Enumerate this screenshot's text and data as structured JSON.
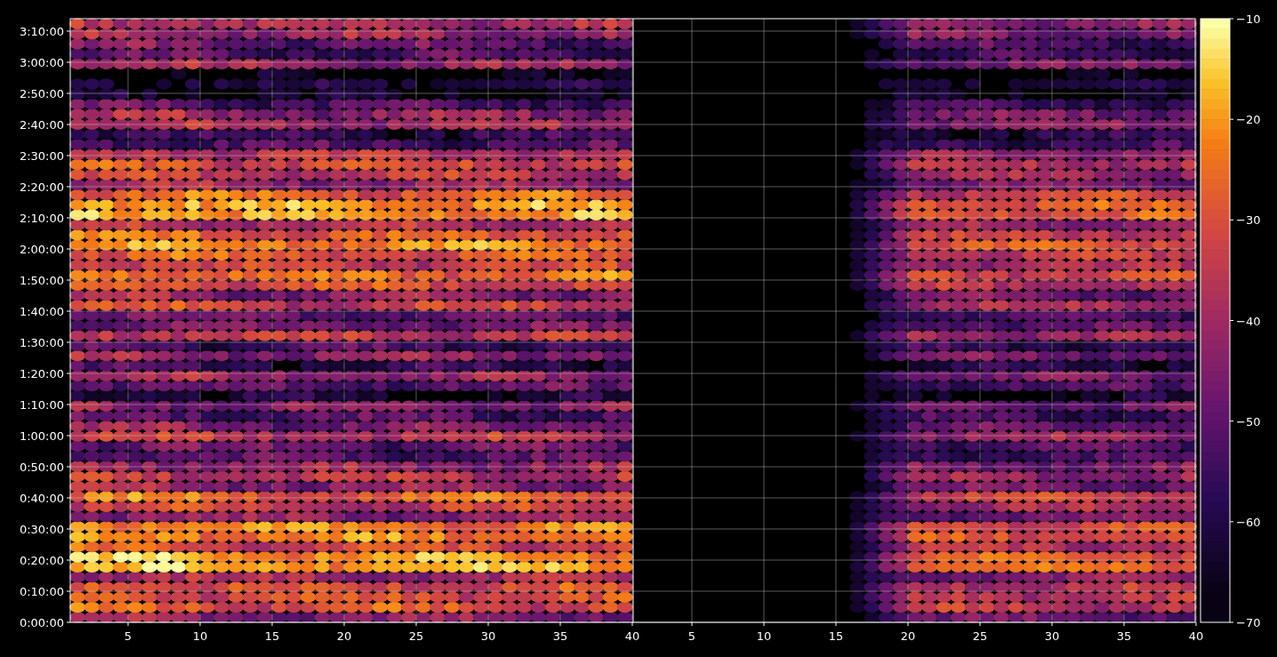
{
  "left_panel": {
    "x_ticks": [
      "5",
      "10",
      "15",
      "20",
      "25",
      "30",
      "35",
      "40"
    ]
  },
  "right_panel": {
    "x_ticks": [
      "5",
      "10",
      "15",
      "20",
      "25",
      "30",
      "35",
      "40"
    ]
  },
  "y_ticks": [
    "3:10:00",
    "3:00:00",
    "2:50:00",
    "2:40:00",
    "2:30:00",
    "2:20:00",
    "2:10:00",
    "2:00:00",
    "1:50:00",
    "1:40:00",
    "1:30:00",
    "1:20:00",
    "1:10:00",
    "1:00:00",
    "0:50:00",
    "0:40:00",
    "0:30:00",
    "0:20:00",
    "0:10:00",
    "0:00:00"
  ],
  "colorbar": {
    "ticks": [
      "−10",
      "−20",
      "−30",
      "−40",
      "−50",
      "−60",
      "−70"
    ]
  }
}
